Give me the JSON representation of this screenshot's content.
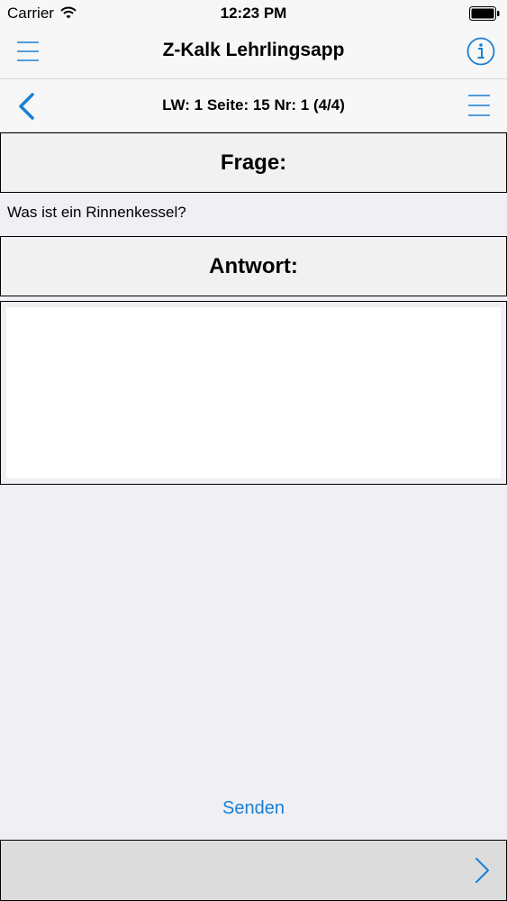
{
  "status_bar": {
    "carrier": "Carrier",
    "time": "12:23 PM"
  },
  "nav": {
    "title": "Z-Kalk Lehrlingsapp"
  },
  "sub_nav": {
    "title": "LW: 1 Seite: 15 Nr: 1 (4/4)"
  },
  "question": {
    "header": "Frage:",
    "text": "Was ist ein Rinnenkessel?"
  },
  "answer": {
    "header": "Antwort:",
    "value": ""
  },
  "actions": {
    "send_label": "Senden"
  },
  "icons": {
    "menu": "hamburger-menu-icon",
    "info": "info-circle-icon",
    "back": "chevron-left-icon",
    "list": "list-icon",
    "next": "chevron-right-icon",
    "wifi": "wifi-icon",
    "battery": "battery-icon"
  },
  "colors": {
    "accent": "#1a7fd4",
    "background": "#efeff4",
    "bar": "#f7f7f7"
  }
}
